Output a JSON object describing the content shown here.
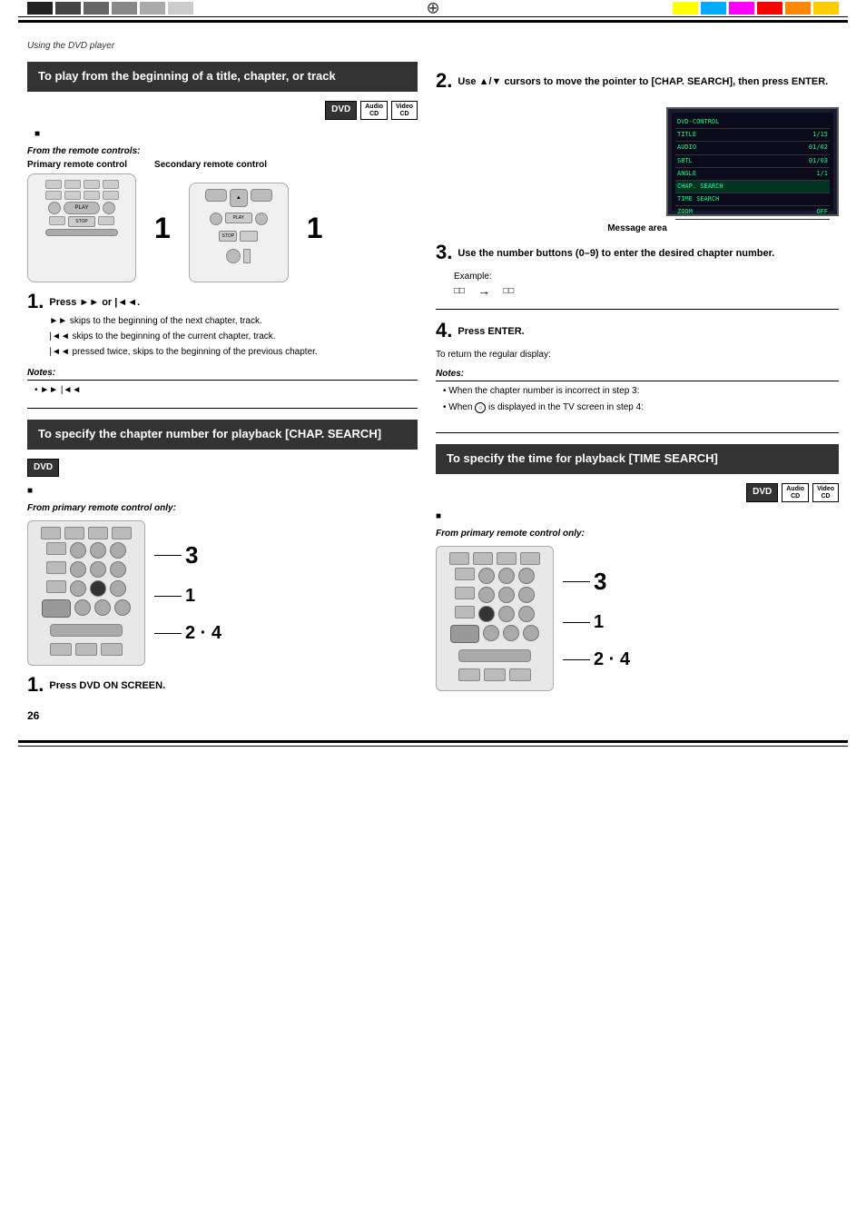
{
  "page": {
    "subtitle": "Using the DVD player",
    "page_number": "26"
  },
  "top_bar": {
    "colors_left": [
      "#333333",
      "#555555",
      "#777777",
      "#888888",
      "#999999",
      "#aaaaaa",
      "#bbbbbb"
    ],
    "colors_right": [
      "#ffff00",
      "#00aaff",
      "#ff00ff",
      "#ff0000",
      "#ff8800",
      "#ffcc00",
      "#ffffff"
    ]
  },
  "left_section": {
    "box_title": "To play from the beginning of a title, chapter, or track",
    "badges": [
      "DVD",
      "Audio CD",
      "Video CD"
    ],
    "bullet_text": "",
    "from_remote_label": "From the remote controls:",
    "primary_label": "Primary remote control",
    "secondary_label": "Secondary remote control",
    "step1_label": "1.",
    "step1_text": "Press ►► or |◄◄.",
    "step1_sub1": "►► skips to the beginning of the next chapter, track.",
    "step1_sub2": "|◄◄ skips to the beginning of the current chapter, track.",
    "step1_sub3": "|◄◄ pressed twice, skips to the beginning of the previous chapter.",
    "notes_label": "Notes:",
    "note1": "►► |◄◄"
  },
  "chap_search_section": {
    "box_title": "To specify the chapter number for playback [CHAP. SEARCH]",
    "badge": "DVD",
    "bullet_text": "",
    "from_remote_label": "From primary remote control only:",
    "step1_label": "1.",
    "step1_text": "Press DVD ON SCREEN."
  },
  "right_section": {
    "step2_label": "2.",
    "step2_text": "Use ▲/▼ cursors to move the pointer to [CHAP. SEARCH], then press ENTER.",
    "dvd_control_rows": [
      {
        "text": "DVD-CONTROL",
        "highlight": false
      },
      {
        "text": "TITLE 1/15",
        "highlight": false
      },
      {
        "text": "AUDIO  01/02",
        "highlight": false
      },
      {
        "text": "SBTL  01/03",
        "highlight": false
      },
      {
        "text": "ANGLE 1/1",
        "highlight": false
      },
      {
        "text": "CHAP. SEARCH",
        "highlight": true
      },
      {
        "text": "TIME SEARCH",
        "highlight": false
      },
      {
        "text": "ZOOM  OFF",
        "highlight": false
      }
    ],
    "message_area_label": "Message area",
    "step3_label": "3.",
    "step3_text": "Use the number buttons (0–9) to enter the desired chapter number.",
    "example_label": "Example:",
    "example_arrow": "→",
    "step4_label": "4.",
    "step4_text": "Press ENTER.",
    "return_display": "To return the regular display:",
    "notes_label": "Notes:",
    "note1": "When the chapter number is incorrect in step 3:",
    "note2": "When",
    "note2_icon": "○",
    "note2_rest": "is displayed in the TV screen in step 4:"
  },
  "time_search_section": {
    "box_title": "To specify the time for playback [TIME SEARCH]",
    "badges": [
      "DVD",
      "Audio CD",
      "Video CD"
    ],
    "bullet_text": "",
    "from_remote_label": "From primary remote control only:"
  }
}
